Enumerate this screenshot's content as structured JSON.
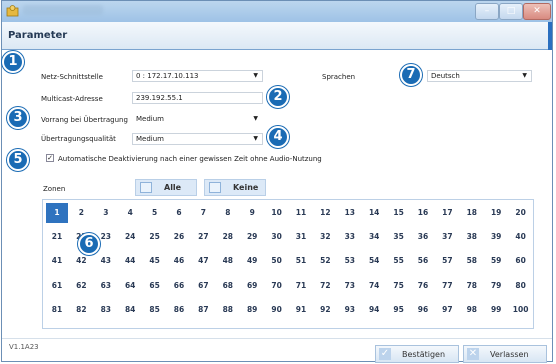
{
  "header": {
    "title": "Parameter"
  },
  "labels": {
    "interface": "Netz-Schnittstelle",
    "multicast": "Multicast-Adresse",
    "priority": "Vorrang bei Übertragung",
    "quality": "Übertragungsqualität",
    "language": "Sprachen",
    "auto_deactivate": "Automatische Deaktivierung nach einer gewissen Zeit ohne Audio-Nutzung",
    "zones": "Zonen"
  },
  "fields": {
    "interface_value": "0 : 172.17.10.113",
    "multicast_value": "239.192.55.1",
    "priority_value": "Medium",
    "quality_value": "Medium",
    "language_value": "Deutsch",
    "auto_deactivate_checked": "✓"
  },
  "buttons": {
    "all": "Alle",
    "none": "Keine",
    "confirm": "Bestätigen",
    "cancel": "Verlassen"
  },
  "badges": [
    "1",
    "2",
    "3",
    "4",
    "5",
    "6",
    "7"
  ],
  "zones": {
    "selected": 1,
    "rows": [
      [
        "1",
        "2",
        "3",
        "4",
        "5",
        "6",
        "7",
        "8",
        "9",
        "10",
        "11",
        "12",
        "13",
        "14",
        "15",
        "16",
        "17",
        "18",
        "19",
        "20"
      ],
      [
        "21",
        "22",
        "23",
        "24",
        "25",
        "26",
        "27",
        "28",
        "29",
        "30",
        "31",
        "32",
        "33",
        "34",
        "35",
        "36",
        "37",
        "38",
        "39",
        "40"
      ],
      [
        "41",
        "42",
        "43",
        "44",
        "45",
        "46",
        "47",
        "48",
        "49",
        "50",
        "51",
        "52",
        "53",
        "54",
        "55",
        "56",
        "57",
        "58",
        "59",
        "60"
      ],
      [
        "61",
        "62",
        "63",
        "64",
        "65",
        "66",
        "67",
        "68",
        "69",
        "70",
        "71",
        "72",
        "73",
        "74",
        "75",
        "76",
        "77",
        "78",
        "79",
        "80"
      ],
      [
        "81",
        "82",
        "83",
        "84",
        "85",
        "86",
        "87",
        "88",
        "89",
        "90",
        "91",
        "92",
        "93",
        "94",
        "95",
        "96",
        "97",
        "98",
        "99",
        "100"
      ]
    ]
  },
  "version": "V1.1A23",
  "colors": {
    "accent": "#1a6bb4",
    "selected_zone": "#2f73bf"
  }
}
